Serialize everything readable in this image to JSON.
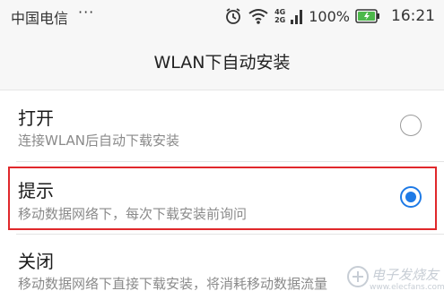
{
  "status_bar": {
    "carrier": "中国电信",
    "more": "···",
    "net_top": "4G",
    "net_bottom": "2G",
    "battery_percent": "100%",
    "time": "16:21"
  },
  "header": {
    "title": "WLAN下自动安装"
  },
  "options": [
    {
      "title": "打开",
      "description": "连接WLAN后自动下载安装",
      "selected": false
    },
    {
      "title": "提示",
      "description": "移动数据网络下，每次下载安装前询问",
      "selected": true
    },
    {
      "title": "关闭",
      "description": "移动数据网络下直接下载安装，将消耗移动数据流量",
      "selected": false
    }
  ],
  "watermark": {
    "text": "电子发烧友",
    "url": "www.elecfans.com"
  },
  "colors": {
    "accent": "#1e7ae6",
    "highlight": "#e0282b",
    "battery": "#4cb84a"
  },
  "icons": [
    "alarm-icon",
    "wifi-icon",
    "signal-icon",
    "battery-icon"
  ]
}
